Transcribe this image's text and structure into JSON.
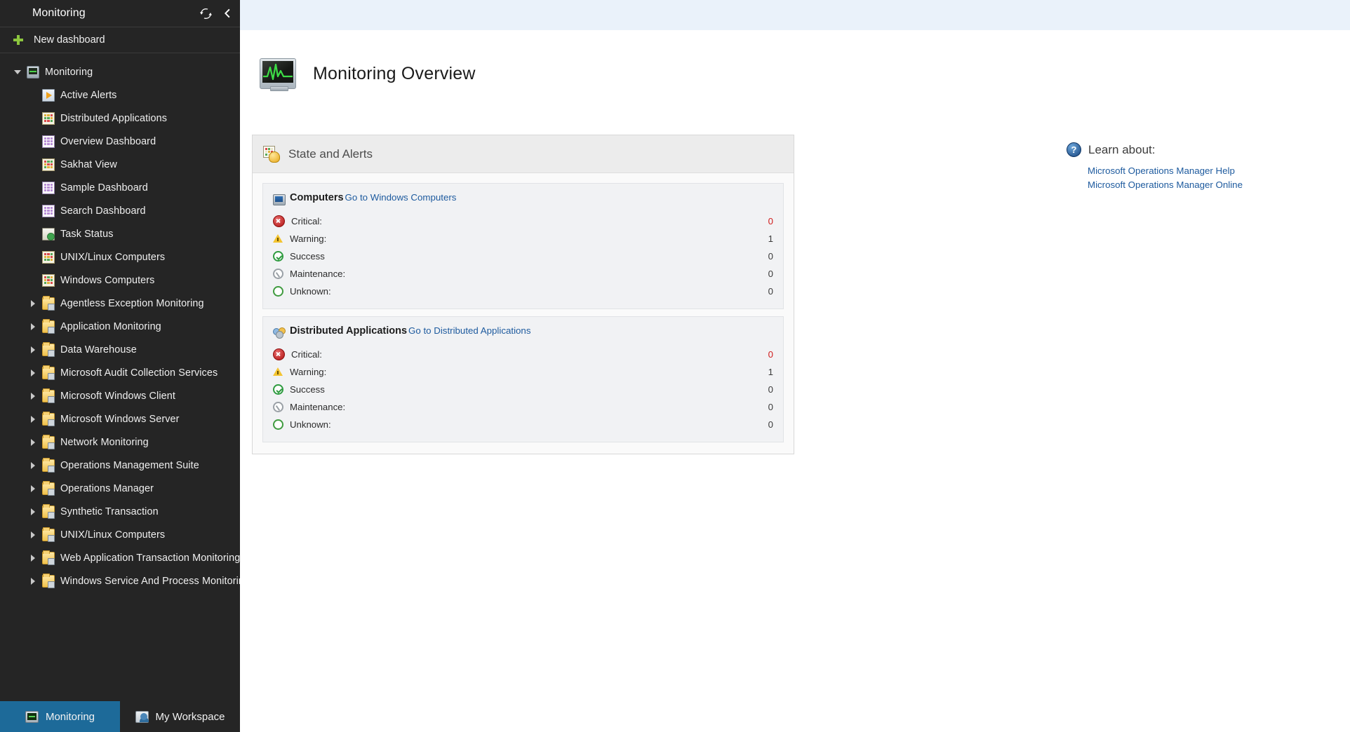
{
  "sidebar": {
    "title": "Monitoring",
    "refresh_icon": "refresh-icon",
    "collapse_icon": "chevron-left-icon",
    "new_dashboard_label": "New dashboard",
    "tree": [
      {
        "label": "Monitoring",
        "icon": "monitor-icon",
        "twisty": "down",
        "depth": 0
      },
      {
        "label": "Active Alerts",
        "icon": "alert-icon",
        "twisty": "none",
        "depth": 1
      },
      {
        "label": "Distributed Applications",
        "icon": "grid-icon",
        "twisty": "none",
        "depth": 1
      },
      {
        "label": "Overview Dashboard",
        "icon": "dashboard-icon",
        "twisty": "none",
        "depth": 1
      },
      {
        "label": "Sakhat View",
        "icon": "grid-icon",
        "twisty": "none",
        "depth": 1
      },
      {
        "label": "Sample Dashboard",
        "icon": "dashboard-icon",
        "twisty": "none",
        "depth": 1
      },
      {
        "label": "Search Dashboard",
        "icon": "dashboard-icon",
        "twisty": "none",
        "depth": 1
      },
      {
        "label": "Task Status",
        "icon": "task-icon",
        "twisty": "none",
        "depth": 1
      },
      {
        "label": "UNIX/Linux Computers",
        "icon": "grid-icon",
        "twisty": "none",
        "depth": 1
      },
      {
        "label": "Windows Computers",
        "icon": "grid-icon",
        "twisty": "none",
        "depth": 1
      },
      {
        "label": "Agentless Exception Monitoring",
        "icon": "folder-icon",
        "twisty": "right",
        "depth": 1
      },
      {
        "label": "Application Monitoring",
        "icon": "folder-icon",
        "twisty": "right",
        "depth": 1
      },
      {
        "label": "Data Warehouse",
        "icon": "folder-icon",
        "twisty": "right",
        "depth": 1
      },
      {
        "label": "Microsoft Audit Collection Services",
        "icon": "folder-icon",
        "twisty": "right",
        "depth": 1
      },
      {
        "label": "Microsoft Windows Client",
        "icon": "folder-icon",
        "twisty": "right",
        "depth": 1
      },
      {
        "label": "Microsoft Windows Server",
        "icon": "folder-icon",
        "twisty": "right",
        "depth": 1
      },
      {
        "label": "Network Monitoring",
        "icon": "folder-icon",
        "twisty": "right",
        "depth": 1
      },
      {
        "label": "Operations Management Suite",
        "icon": "folder-icon",
        "twisty": "right",
        "depth": 1
      },
      {
        "label": "Operations Manager",
        "icon": "folder-icon",
        "twisty": "right",
        "depth": 1
      },
      {
        "label": "Synthetic Transaction",
        "icon": "folder-icon",
        "twisty": "right",
        "depth": 1
      },
      {
        "label": "UNIX/Linux Computers",
        "icon": "folder-icon",
        "twisty": "right",
        "depth": 1
      },
      {
        "label": "Web Application Transaction Monitoring",
        "icon": "folder-icon",
        "twisty": "right",
        "depth": 1
      },
      {
        "label": "Windows Service And Process Monitoring",
        "icon": "folder-icon",
        "twisty": "right",
        "depth": 1
      }
    ]
  },
  "bottom_tabs": [
    {
      "label": "Monitoring",
      "icon": "monitor-icon",
      "active": true
    },
    {
      "label": "My Workspace",
      "icon": "workspace-icon",
      "active": false
    }
  ],
  "main": {
    "page_title": "Monitoring Overview",
    "page_icon": "ekg-monitor-icon",
    "state_panel": {
      "title": "State and Alerts",
      "icon": "state-alerts-icon",
      "sections": [
        {
          "title": "Computers",
          "icon": "computers-icon",
          "link": "Go to Windows Computers",
          "rows": [
            {
              "label": "Critical:",
              "value": "0",
              "icon": "critical-icon",
              "critical": true
            },
            {
              "label": "Warning:",
              "value": "1",
              "icon": "warning-icon",
              "critical": false
            },
            {
              "label": "Success",
              "value": "0",
              "icon": "success-icon",
              "critical": false
            },
            {
              "label": "Maintenance:",
              "value": "0",
              "icon": "maintenance-icon",
              "critical": false
            },
            {
              "label": "Unknown:",
              "value": "0",
              "icon": "unknown-icon",
              "critical": false
            }
          ]
        },
        {
          "title": "Distributed Applications",
          "icon": "distributed-applications-icon",
          "link": "Go to Distributed Applications",
          "rows": [
            {
              "label": "Critical:",
              "value": "0",
              "icon": "critical-icon",
              "critical": true
            },
            {
              "label": "Warning:",
              "value": "1",
              "icon": "warning-icon",
              "critical": false
            },
            {
              "label": "Success",
              "value": "0",
              "icon": "success-icon",
              "critical": false
            },
            {
              "label": "Maintenance:",
              "value": "0",
              "icon": "maintenance-icon",
              "critical": false
            },
            {
              "label": "Unknown:",
              "value": "0",
              "icon": "unknown-icon",
              "critical": false
            }
          ]
        }
      ]
    },
    "learn": {
      "title": "Learn about:",
      "icon": "help-icon",
      "links": [
        "Microsoft Operations Manager Help",
        "Microsoft Operations Manager Online"
      ]
    }
  },
  "colors": {
    "sidebar_bg": "#252525",
    "active_tab": "#1d6a99",
    "link": "#1d5a9e",
    "critical": "#d01c1c",
    "accent_green": "#8cc63e",
    "top_strip": "#eaf2fa"
  }
}
